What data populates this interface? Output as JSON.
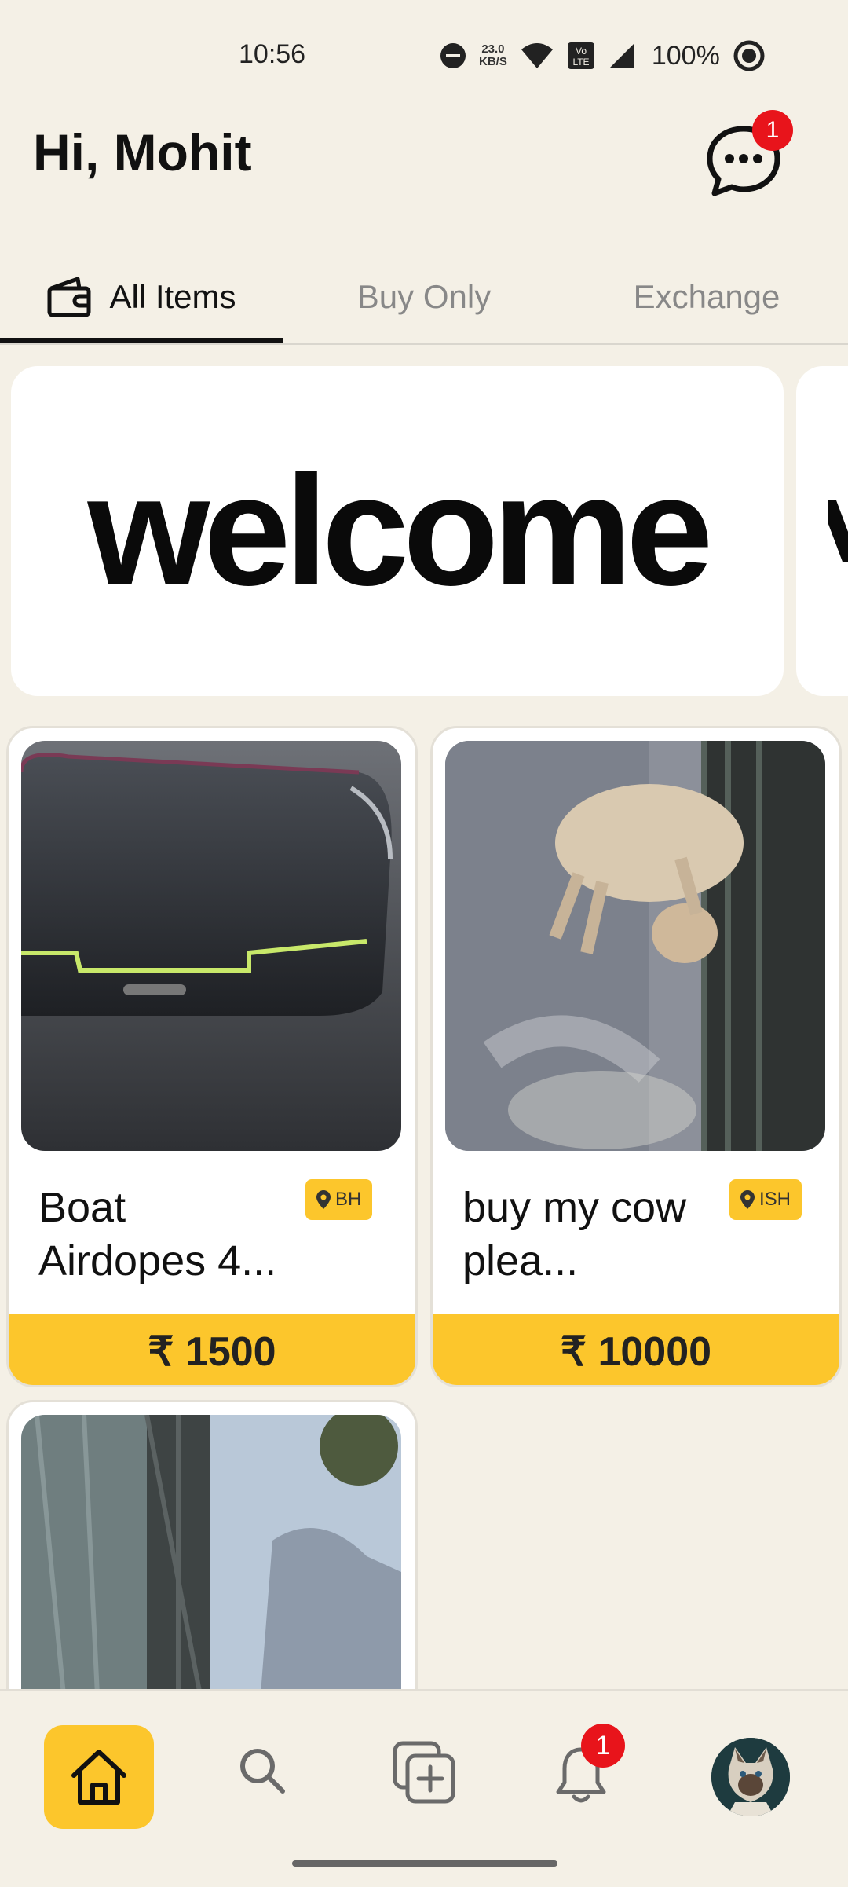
{
  "status_bar": {
    "time": "10:56",
    "speed_value": "23.0",
    "speed_unit": "KB/S",
    "battery": "100%",
    "icons": [
      "dnd-icon",
      "wifi-icon",
      "volte-icon",
      "signal-icon",
      "battery-saver-icon"
    ]
  },
  "header": {
    "greeting": "Hi, Mohit",
    "chat_badge": "1"
  },
  "tabs": [
    {
      "label": "All Items",
      "active": true
    },
    {
      "label": "Buy Only",
      "active": false
    },
    {
      "label": "Exchange",
      "active": false
    }
  ],
  "banner": {
    "text": "welcome"
  },
  "products": [
    {
      "title": "Boat Airdopes 4...",
      "title_line1": "Boat",
      "title_line2": "Airdopes 4...",
      "location": "BH",
      "price": "₹ 1500"
    },
    {
      "title": "buy my cow plea...",
      "title_line1": "buy my cow",
      "title_line2": "plea...",
      "location": "ISH",
      "price": "₹ 10000"
    },
    {
      "title": "",
      "location": "",
      "price": ""
    }
  ],
  "bottom_nav": {
    "items": [
      "home-icon",
      "search-icon",
      "add-item-icon",
      "bell-icon",
      "avatar"
    ],
    "notification_badge": "1"
  },
  "colors": {
    "background": "#F4F0E6",
    "accent": "#FCC62C",
    "badge": "#E8141B"
  }
}
